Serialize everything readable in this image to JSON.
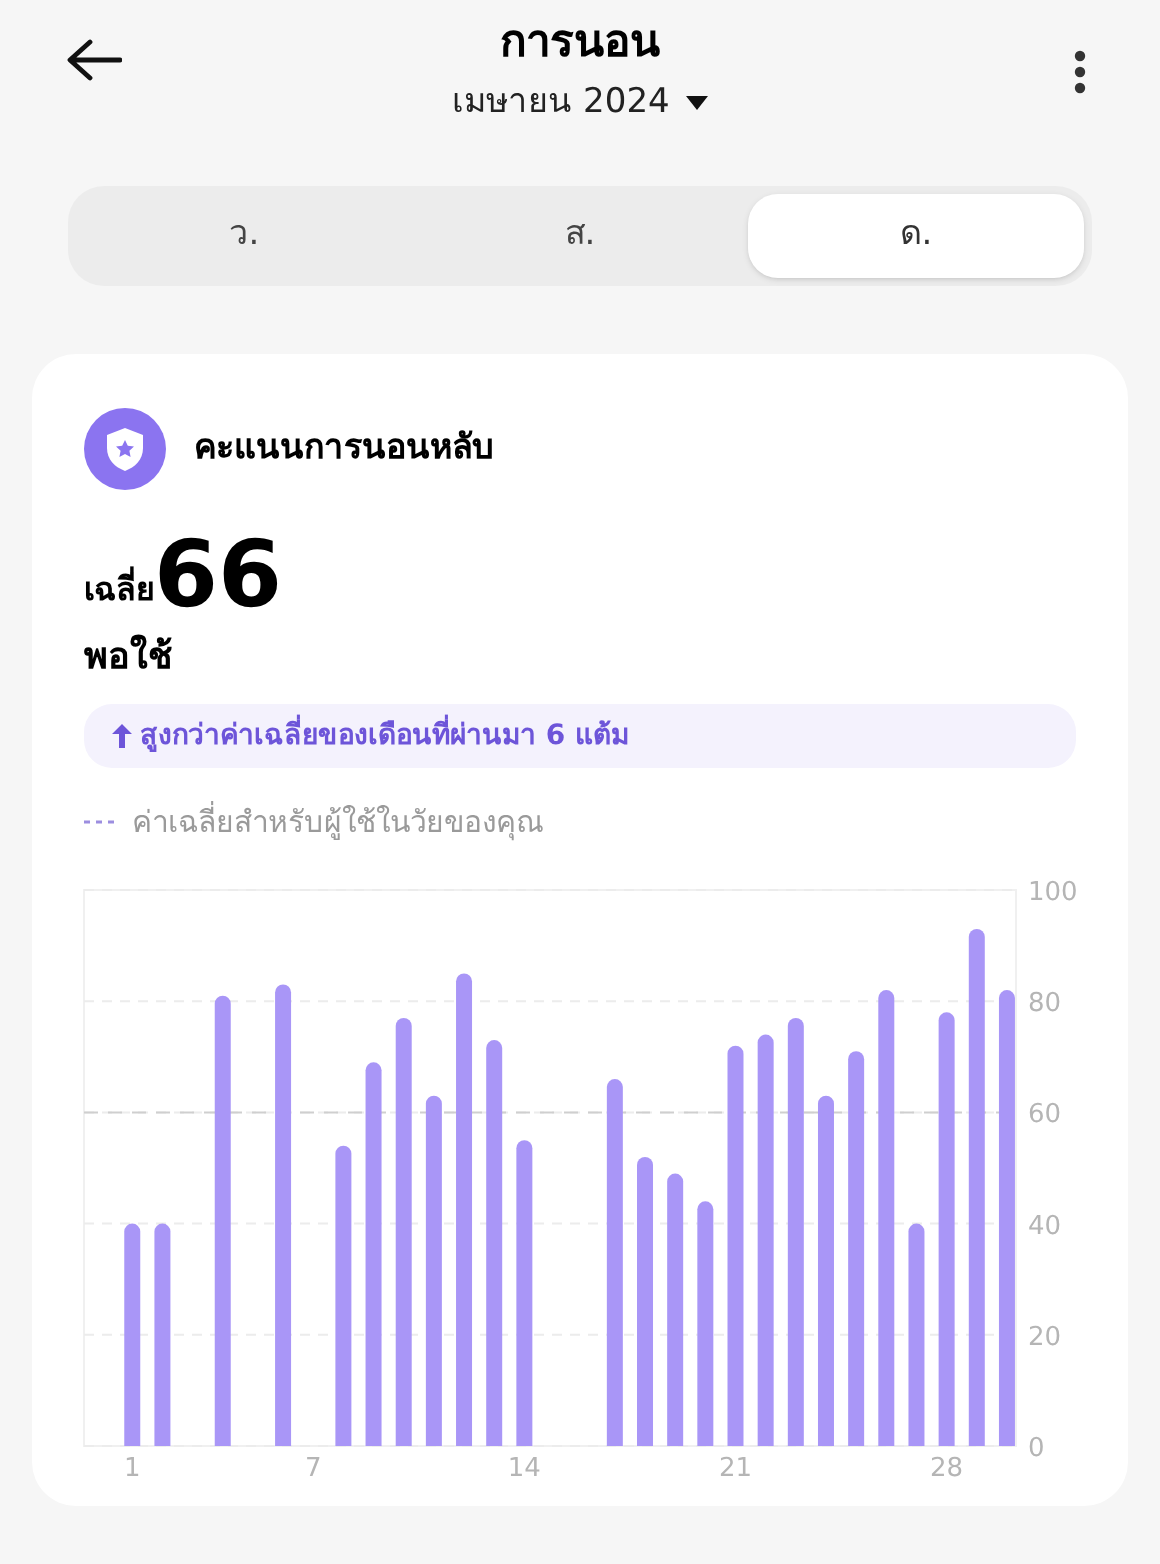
{
  "header": {
    "title": "การนอน",
    "period": "เมษายน 2024"
  },
  "tabs": [
    {
      "label": "ว.",
      "selected": false
    },
    {
      "label": "ส.",
      "selected": false
    },
    {
      "label": "ด.",
      "selected": true
    }
  ],
  "card": {
    "title": "คะแนนการนอนหลับ",
    "average_label": "เฉลี่ย",
    "average_value": "66",
    "rating": "พอใช้",
    "comparison": "สูงกว่าค่าเฉลี่ยของเดือนที่ผ่านมา 6 แต้ม",
    "legend": "ค่าเฉลี่ยสำหรับผู้ใช้ในวัยของคุณ",
    "chart_data": {
      "type": "bar",
      "x": [
        1,
        2,
        3,
        4,
        5,
        6,
        7,
        8,
        9,
        10,
        11,
        12,
        13,
        14,
        15,
        16,
        17,
        18,
        19,
        20,
        21,
        22,
        23,
        24,
        25,
        26,
        27,
        28,
        29,
        30
      ],
      "xlim": [
        -0.6,
        30.3
      ],
      "grid": true,
      "series": [
        {
          "color": "#a996f7",
          "values": [
            40,
            40,
            null,
            81,
            null,
            83,
            null,
            54,
            69,
            77,
            63,
            85,
            73,
            55,
            null,
            null,
            66,
            52,
            49,
            44,
            72,
            74,
            77,
            63,
            71,
            82,
            40,
            78,
            93,
            82
          ]
        }
      ],
      "xticks": [
        1,
        7,
        14,
        21,
        28
      ],
      "yticks": [
        0,
        20,
        40,
        60,
        80,
        100
      ],
      "ylim": [
        0,
        100
      ],
      "ref_lines": [
        {
          "axis": "y",
          "value": 60
        }
      ]
    }
  }
}
